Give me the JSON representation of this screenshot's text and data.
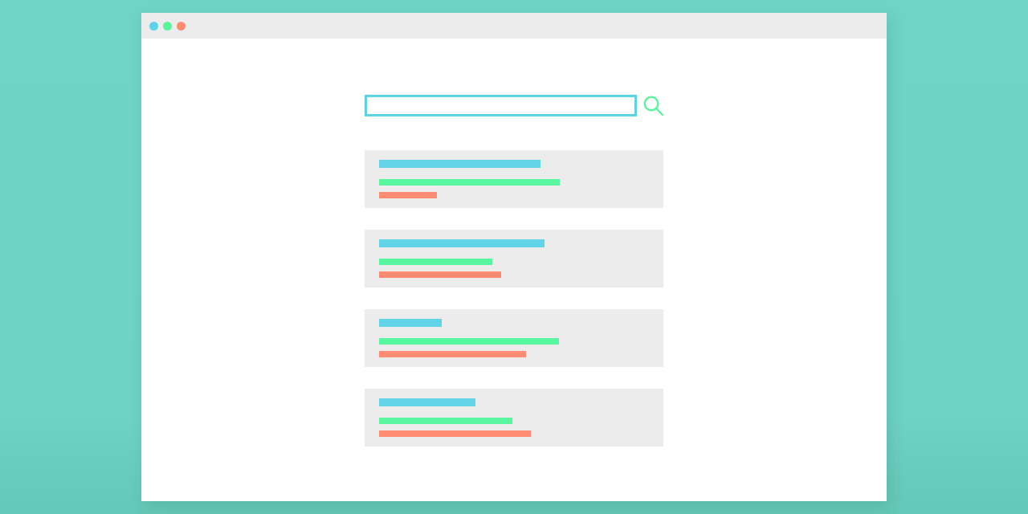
{
  "window": {
    "controls": [
      {
        "color": "#5dd3e8"
      },
      {
        "color": "#5af59b"
      },
      {
        "color": "#fe8b70"
      }
    ]
  },
  "results": [
    {
      "lines": [
        {
          "kind": "title",
          "color": "#61d4e7"
        },
        {
          "kind": "text",
          "color": "#58f69f"
        },
        {
          "kind": "text",
          "color": "#fe8b72"
        }
      ]
    },
    {
      "lines": [
        {
          "kind": "title",
          "color": "#61d4e7"
        },
        {
          "kind": "text",
          "color": "#58f69f"
        },
        {
          "kind": "text",
          "color": "#fe8b72"
        }
      ]
    },
    {
      "lines": [
        {
          "kind": "title",
          "color": "#61d4e7"
        },
        {
          "kind": "text",
          "color": "#58f69f"
        },
        {
          "kind": "text",
          "color": "#fe8b72"
        }
      ]
    },
    {
      "lines": [
        {
          "kind": "title",
          "color": "#61d4e7"
        },
        {
          "kind": "text",
          "color": "#58f69f"
        },
        {
          "kind": "text",
          "color": "#fe8b72"
        }
      ]
    }
  ]
}
